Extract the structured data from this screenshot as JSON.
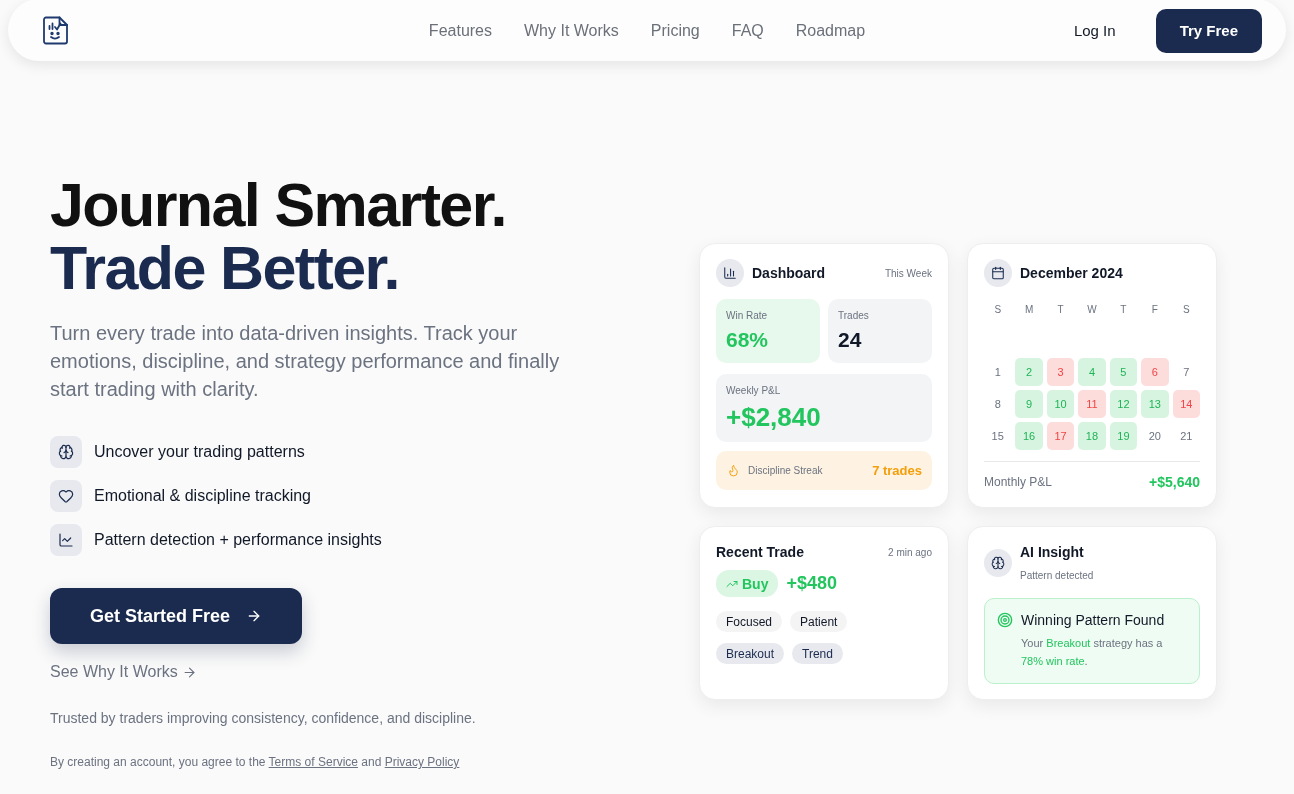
{
  "nav": {
    "links": [
      "Features",
      "Why It Works",
      "Pricing",
      "FAQ",
      "Roadmap"
    ],
    "login": "Log In",
    "cta": "Try Free"
  },
  "hero": {
    "headline": "Journal Smarter.",
    "headline_accent": "Trade Better.",
    "intro": "Turn every trade into data-driven insights. Track your emotions, discipline, and strategy performance and finally start trading with clarity.",
    "features": [
      "Uncover your trading patterns",
      "Emotional & discipline tracking",
      "Pattern detection + performance insights"
    ],
    "primary_button": "Get Started Free",
    "secondary_link": "See Why It Works",
    "trust_line": "Trusted by traders improving consistency, confidence, and discipline.",
    "legal": {
      "text": "By creating an account, you agree to the",
      "terms_link": "Terms of Service",
      "joiner": "and",
      "privacy_link": "Privacy Policy"
    }
  },
  "dashboard": {
    "title": "Dashboard",
    "period": "This Week",
    "stats": [
      {
        "label": "Win Rate",
        "value": "68%",
        "kind": "positive"
      },
      {
        "label": "Trades",
        "value": "24",
        "kind": "neutral"
      }
    ],
    "weekly": {
      "label": "Weekly P&L",
      "value": "+$2,840"
    },
    "streak": {
      "label": "Discipline Streak",
      "value": "7 trades"
    }
  },
  "calendar": {
    "title": "December 2024",
    "weekdays": [
      "S",
      "M",
      "T",
      "W",
      "T",
      "F",
      "S"
    ],
    "days": [
      {
        "day": "1",
        "kind": "plain"
      },
      {
        "day": "2",
        "kind": "win"
      },
      {
        "day": "3",
        "kind": "loss"
      },
      {
        "day": "4",
        "kind": "win"
      },
      {
        "day": "5",
        "kind": "win"
      },
      {
        "day": "6",
        "kind": "loss"
      },
      {
        "day": "7",
        "kind": "plain"
      },
      {
        "day": "8",
        "kind": "plain"
      },
      {
        "day": "9",
        "kind": "win"
      },
      {
        "day": "10",
        "kind": "win"
      },
      {
        "day": "11",
        "kind": "loss"
      },
      {
        "day": "12",
        "kind": "win"
      },
      {
        "day": "13",
        "kind": "win"
      },
      {
        "day": "14",
        "kind": "loss"
      },
      {
        "day": "15",
        "kind": "plain"
      },
      {
        "day": "16",
        "kind": "win"
      },
      {
        "day": "17",
        "kind": "loss"
      },
      {
        "day": "18",
        "kind": "win"
      },
      {
        "day": "19",
        "kind": "win"
      },
      {
        "day": "20",
        "kind": "plain"
      },
      {
        "day": "21",
        "kind": "plain"
      }
    ],
    "summary": {
      "label": "Monthly P&L",
      "value": "+$5,640"
    }
  },
  "recent_trade": {
    "title": "Recent Trade",
    "time": "2 min ago",
    "side": "Buy",
    "pnl": "+$480",
    "emotions": [
      "Focused",
      "Patient"
    ],
    "strategies": [
      "Breakout",
      "Trend"
    ]
  },
  "ai_insight": {
    "title": "AI Insight",
    "subtitle": "Pattern detected",
    "finding": {
      "title": "Winning Pattern Found",
      "text": "Your **Breakout** strategy has a **78% win rate**."
    }
  }
}
